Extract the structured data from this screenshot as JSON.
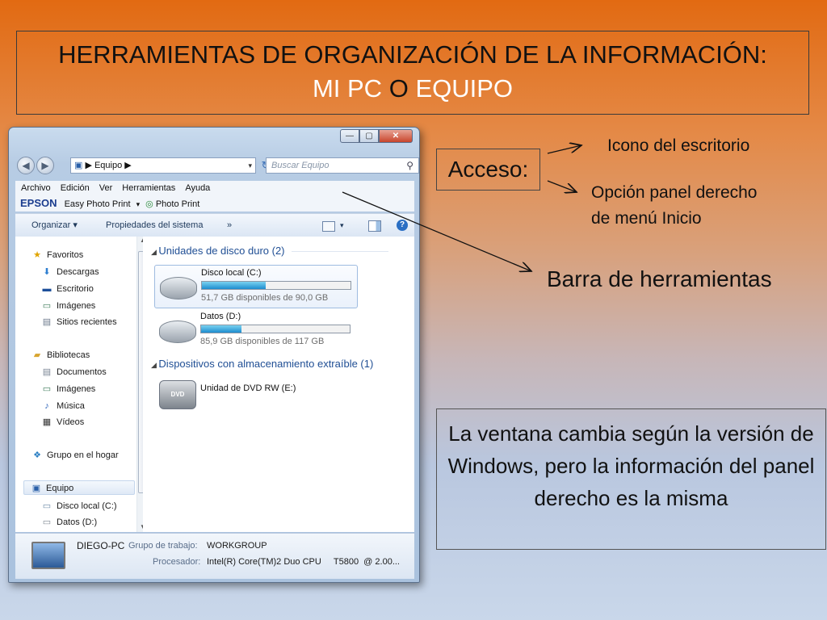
{
  "slide": {
    "title_line1": "HERRAMIENTAS DE ORGANIZACIÓN DE LA INFORMACIÓN:",
    "title_line2_part1": "MI PC",
    "title_line2_part2": "O",
    "title_line2_part3": "EQUIPO",
    "acceso_label": "Acceso:",
    "note_icon": "Icono del escritorio",
    "note_option_line1": "Opción panel derecho",
    "note_option_line2": "de menú Inicio",
    "note_toolbar": "Barra de herramientas",
    "info_box": "La ventana cambia según la versión de Windows, pero la información del panel derecho es la misma"
  },
  "window": {
    "caption_buttons": {
      "min": "—",
      "max": "▢",
      "close": "✕"
    },
    "address": {
      "icon": "computer-icon",
      "path": "▶ Equipo ▶",
      "dropdown": "▾"
    },
    "search_placeholder": "Buscar Equipo",
    "menu": [
      "Archivo",
      "Edición",
      "Ver",
      "Herramientas",
      "Ayuda"
    ],
    "epson": {
      "logo": "EPSON",
      "easy": "Easy Photo Print",
      "photo": "Photo Print"
    },
    "command_bar": {
      "organize": "Organizar ▾",
      "props": "Propiedades del sistema",
      "more": "»",
      "help": "?"
    },
    "nav": {
      "favorites": "Favoritos",
      "fav_items": [
        "Descargas",
        "Escritorio",
        "Imágenes",
        "Sitios recientes"
      ],
      "libraries": "Bibliotecas",
      "lib_items": [
        "Documentos",
        "Imágenes",
        "Música",
        "Vídeos"
      ],
      "homegroup": "Grupo en el hogar",
      "computer": "Equipo",
      "drives": [
        "Disco local (C:)",
        "Datos (D:)"
      ]
    },
    "main": {
      "group_hdd": "Unidades de disco duro (2)",
      "group_removable": "Dispositivos con almacenamiento extraíble (1)",
      "drive_c": {
        "name": "Disco local (C:)",
        "free_text": "51,7 GB disponibles de 90,0 GB",
        "used_fraction": 0.43
      },
      "drive_d": {
        "name": "Datos (D:)",
        "free_text": "85,9 GB disponibles de 117 GB",
        "used_fraction": 0.27
      },
      "dvd": {
        "name": "Unidad de DVD RW (E:)",
        "badge": "DVD"
      }
    },
    "details": {
      "pc_name": "DIEGO-PC",
      "workgroup_label": "Grupo de trabajo:",
      "workgroup": "WORKGROUP",
      "cpu_label": "Procesador:",
      "cpu": "Intel(R) Core(TM)2 Duo CPU     T5800  @ 2.00..."
    }
  }
}
